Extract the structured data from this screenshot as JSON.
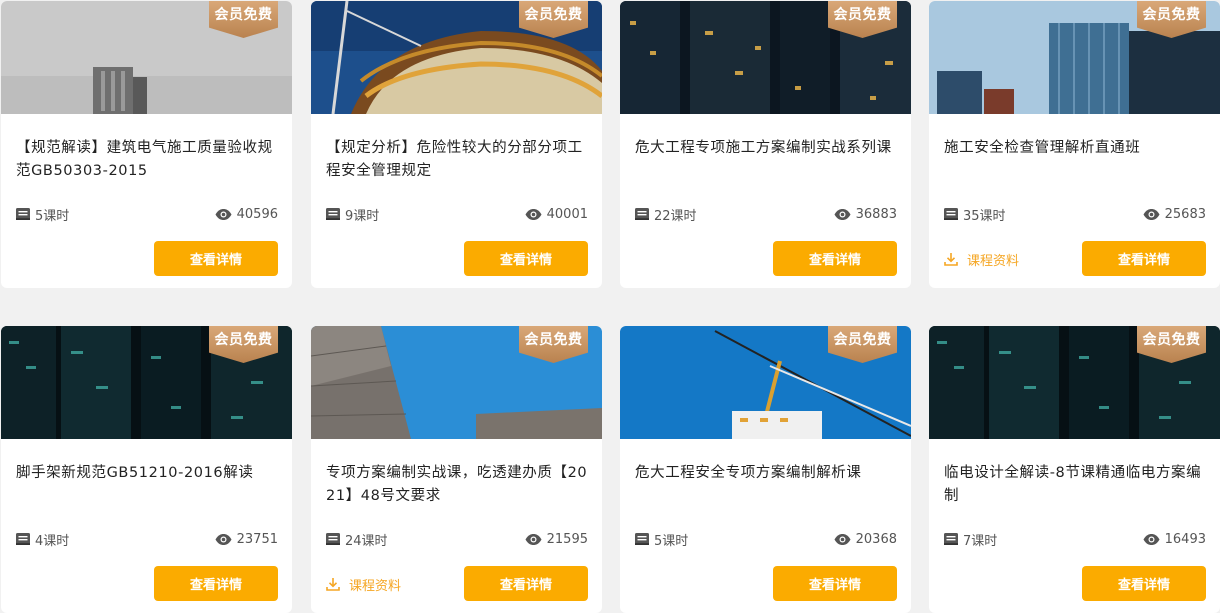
{
  "badge_text": "会员免费",
  "detail_label": "查看详情",
  "materials_label": "课程资料",
  "courses": [
    {
      "title": "【规范解读】建筑电气施工质量验收规范GB50303-2015",
      "lessons": "5课时",
      "views": "40596",
      "has_materials": false,
      "thumb": "grey-sky-tower"
    },
    {
      "title": "【规定分析】危险性较大的分部分项工程安全管理规定",
      "lessons": "9课时",
      "views": "40001",
      "has_materials": false,
      "thumb": "construction-crane-building"
    },
    {
      "title": "危大工程专项施工方案编制实战系列课",
      "lessons": "22课时",
      "views": "36883",
      "has_materials": false,
      "thumb": "night-city-towers"
    },
    {
      "title": "施工安全检查管理解析直通班",
      "lessons": "35课时",
      "views": "25683",
      "has_materials": true,
      "thumb": "glass-office-towers"
    },
    {
      "title": "脚手架新规范GB51210-2016解读",
      "lessons": "4课时",
      "views": "23751",
      "has_materials": false,
      "thumb": "night-city-teal"
    },
    {
      "title": "专项方案编制实战课，吃透建办质【2021】48号文要求",
      "lessons": "24课时",
      "views": "21595",
      "has_materials": true,
      "thumb": "modern-facade-blue-sky"
    },
    {
      "title": "危大工程安全专项方案编制解析课",
      "lessons": "5课时",
      "views": "20368",
      "has_materials": false,
      "thumb": "tower-crane-blue-sky"
    },
    {
      "title": "临电设计全解读-8节课精通临电方案编制",
      "lessons": "7课时",
      "views": "16493",
      "has_materials": false,
      "thumb": "night-city-teal"
    }
  ]
}
